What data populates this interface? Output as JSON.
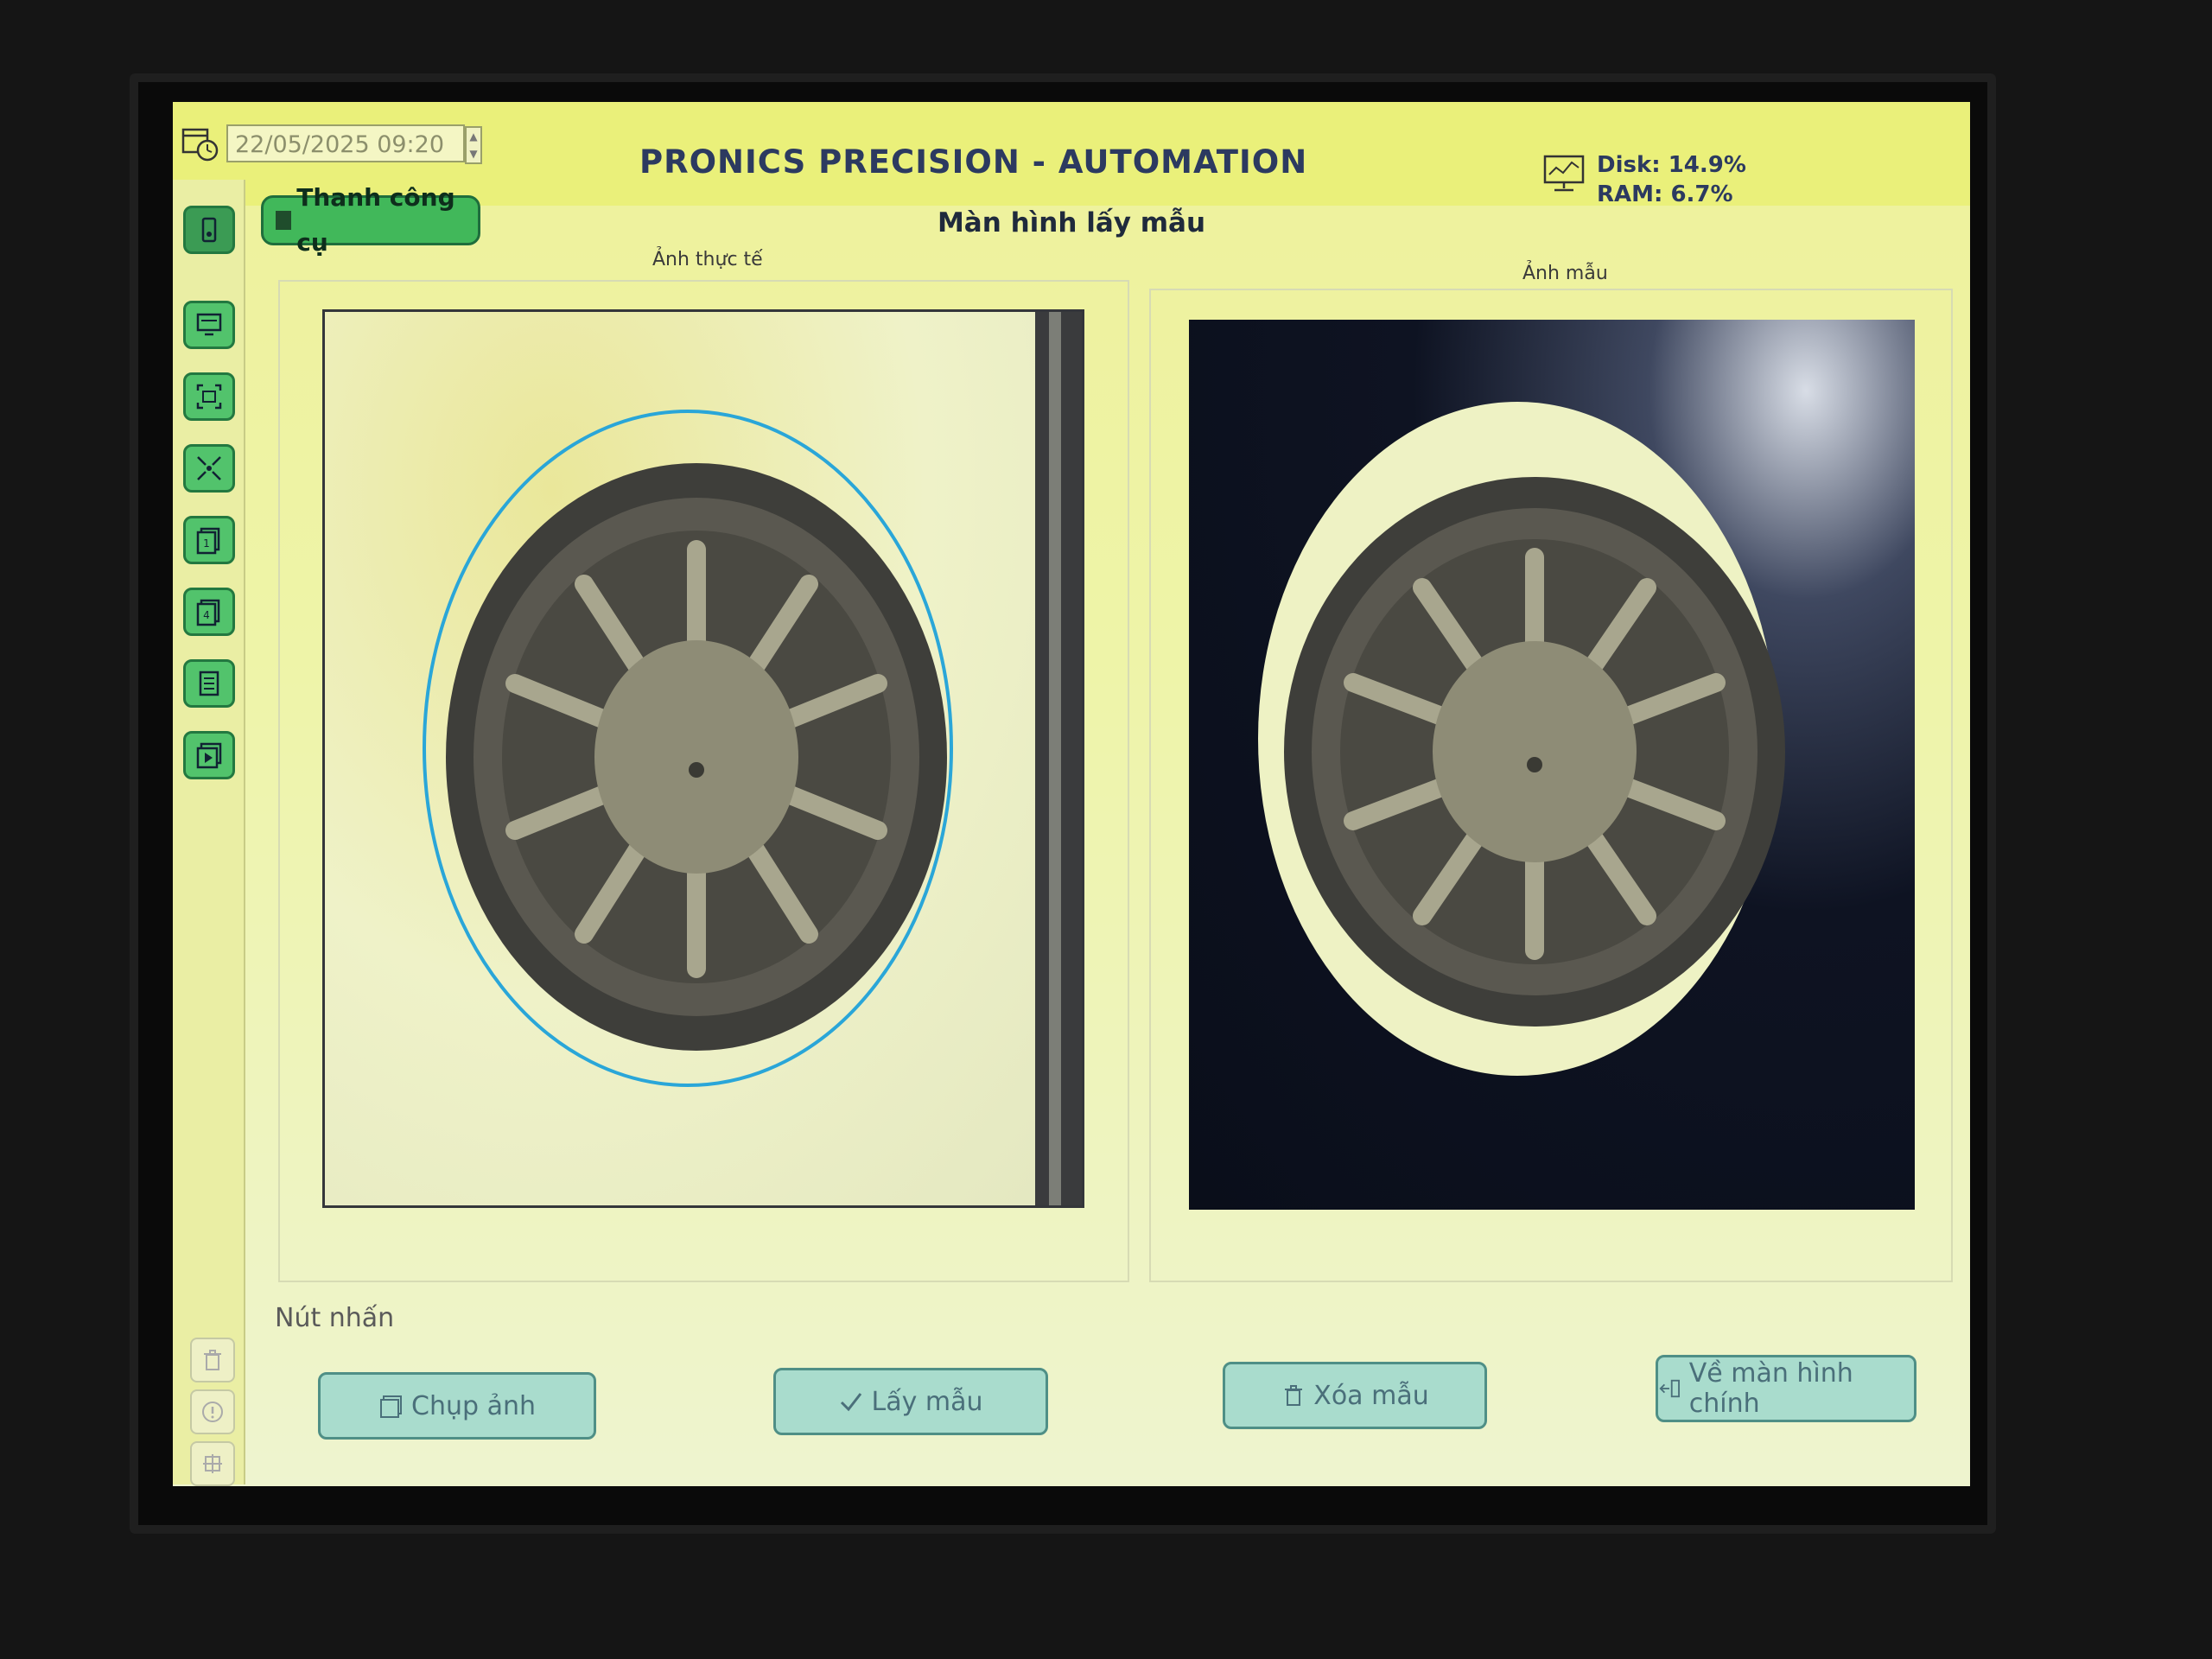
{
  "header": {
    "datetime": "22/05/2025 09:20",
    "app_title": "PRONICS PRECISION - AUTOMATION",
    "disk_label": "Disk: 14.9%",
    "ram_label": "RAM: 6.7%"
  },
  "toolbar": {
    "toggle_label": "Thanh công cụ"
  },
  "page": {
    "title": "Màn hình lấy mẫu"
  },
  "panels": {
    "actual_label": "Ảnh thực tế",
    "sample_label": "Ảnh mẫu"
  },
  "buttons_section": {
    "label": "Nút nhấn",
    "capture": "Chụp ảnh",
    "take_sample": "Lấy mẫu",
    "delete_sample": "Xóa mẫu",
    "back_main": "Về màn hình chính"
  },
  "sidebar": {
    "icons": [
      "camera-icon",
      "monitor-icon",
      "frame-icon",
      "crosshair-icon",
      "page-1-icon",
      "page-4-icon",
      "list-icon",
      "media-icon"
    ],
    "bottom_icons": [
      "trash-icon",
      "info-icon",
      "expand-icon"
    ]
  },
  "colors": {
    "screen_bg": "#eef4a8",
    "toolbar_green": "#41b85a",
    "action_button": "#a9dccd",
    "title_text": "#2c3a60",
    "detection_circle": "#2aa6d8"
  }
}
